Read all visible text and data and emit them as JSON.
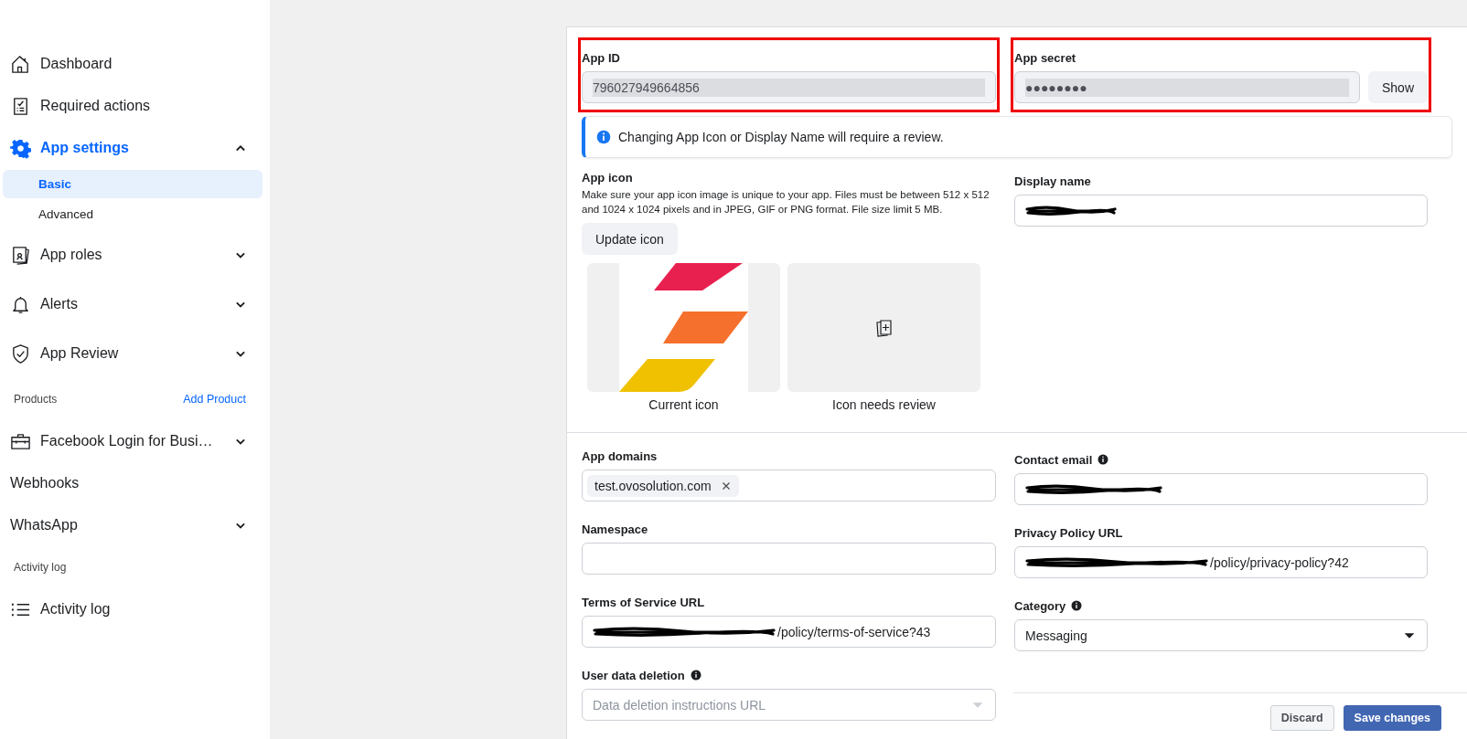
{
  "sidebar": {
    "items": [
      {
        "kind": "item",
        "label": "Dashboard",
        "selected": false
      },
      {
        "kind": "item",
        "label": "Required actions",
        "selected": false
      },
      {
        "kind": "item",
        "label": "App settings",
        "selected": true,
        "expanded": true,
        "children": [
          {
            "label": "Basic",
            "selected": true
          },
          {
            "label": "Advanced",
            "selected": false
          }
        ]
      },
      {
        "kind": "item",
        "label": "App roles",
        "selected": false,
        "expanded": false
      },
      {
        "kind": "item",
        "label": "Alerts",
        "selected": false,
        "expanded": false
      },
      {
        "kind": "item",
        "label": "App Review",
        "selected": false,
        "expanded": false
      },
      {
        "kind": "section",
        "label": "Products",
        "action": "Add Product"
      },
      {
        "kind": "item",
        "label": "Facebook Login for Busi…",
        "selected": false,
        "expanded": false
      },
      {
        "kind": "item",
        "label": "Webhooks",
        "selected": false
      },
      {
        "kind": "item",
        "label": "WhatsApp",
        "selected": false,
        "expanded": false
      },
      {
        "kind": "section",
        "label": "Activity log"
      },
      {
        "kind": "item",
        "label": "Activity log",
        "selected": false
      }
    ]
  },
  "app_id": {
    "label": "App ID",
    "value": "796027949664856",
    "highlighted": true
  },
  "app_secret": {
    "label": "App secret",
    "value": "●●●●●●●●",
    "button": "Show",
    "highlighted": true
  },
  "notice": "Changing App Icon or Display Name will require a review.",
  "app_icon": {
    "label": "App icon",
    "description": "Make sure your app icon image is unique to your app. Files must be between 512 x 512 and 1024 x 1024 pixels and in JPEG, GIF or PNG format. File size limit 5 MB.",
    "button": "Update icon",
    "tiles": [
      {
        "kind": "picture",
        "caption": "Current icon"
      },
      {
        "kind": "placeholder",
        "caption": "Icon needs review"
      }
    ]
  },
  "display_name": {
    "label": "Display name",
    "redacted": true
  },
  "fields": {
    "left": [
      {
        "kind": "tags",
        "label": "App domains",
        "tags": [
          "test.ovosolution.com"
        ]
      },
      {
        "kind": "text",
        "label": "Namespace"
      },
      {
        "kind": "text",
        "label": "Terms of Service URL",
        "value": "/policy/terms-of-service?43",
        "redacted": true
      },
      {
        "kind": "select",
        "label": "User data deletion",
        "info": true,
        "placeholder": "Data deletion instructions URL"
      }
    ],
    "right": [
      {
        "kind": "text",
        "label": "Contact email",
        "info": true,
        "redacted": true
      },
      {
        "kind": "text",
        "label": "Privacy Policy URL",
        "value": "/policy/privacy-policy?42",
        "redacted": true
      },
      {
        "kind": "select",
        "label": "Category",
        "info": true,
        "value": "Messaging"
      }
    ]
  },
  "footer": {
    "buttons": [
      {
        "kind": "secondary",
        "label": "Discard"
      },
      {
        "kind": "primary",
        "label": "Save changes"
      }
    ]
  }
}
